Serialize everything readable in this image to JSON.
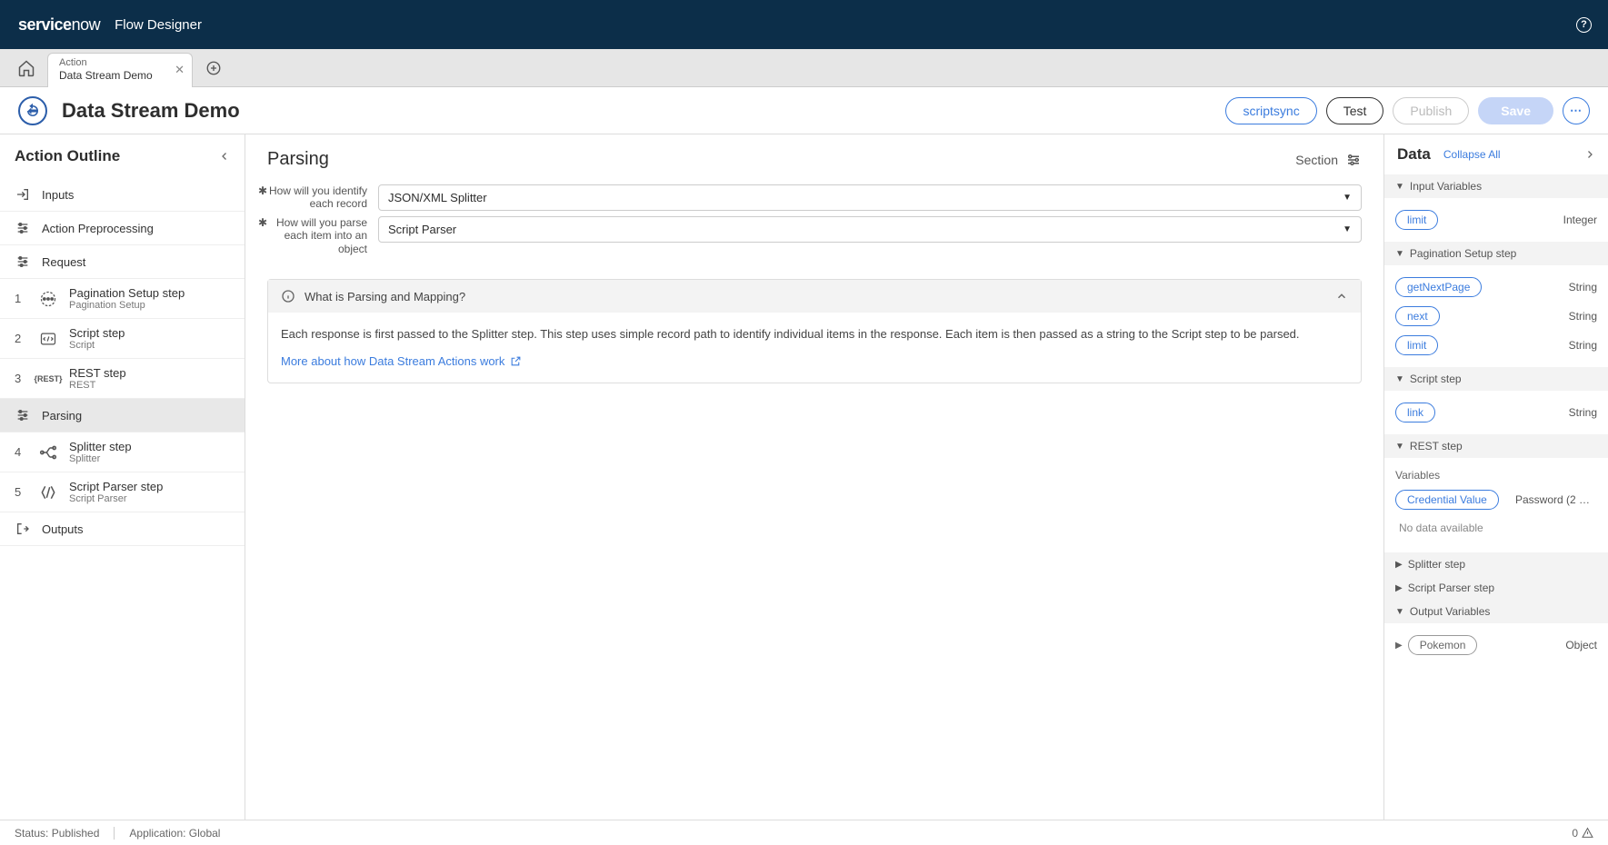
{
  "brand": {
    "name1": "service",
    "name2": "now",
    "product": "Flow Designer"
  },
  "tab": {
    "type": "Action",
    "name": "Data Stream Demo"
  },
  "page": {
    "title": "Data Stream Demo"
  },
  "headerButtons": {
    "scriptsync": "scriptsync",
    "test": "Test",
    "publish": "Publish",
    "save": "Save"
  },
  "outline": {
    "title": "Action Outline",
    "inputs": "Inputs",
    "preprocessing": "Action Preprocessing",
    "request": "Request",
    "parsing": "Parsing",
    "outputs": "Outputs",
    "steps": [
      {
        "num": "1",
        "title": "Pagination Setup step",
        "sub": "Pagination Setup"
      },
      {
        "num": "2",
        "title": "Script step",
        "sub": "Script"
      },
      {
        "num": "3",
        "title": "REST step",
        "sub": "REST"
      }
    ],
    "parseSteps": [
      {
        "num": "4",
        "title": "Splitter step",
        "sub": "Splitter"
      },
      {
        "num": "5",
        "title": "Script Parser step",
        "sub": "Script Parser"
      }
    ]
  },
  "center": {
    "title": "Parsing",
    "sectionLabel": "Section",
    "field1": {
      "label": "How will you identify each record",
      "value": "JSON/XML Splitter"
    },
    "field2": {
      "label": "How will you parse each item into an object",
      "value": "Script Parser"
    },
    "info": {
      "header": "What is Parsing and Mapping?",
      "body": "Each response is first passed to the Splitter step. This step uses simple record path to identify individual items in the response. Each item is then passed as a string to the Script step to be parsed.",
      "link": "More about how Data Stream Actions work"
    }
  },
  "dataPanel": {
    "title": "Data",
    "collapseAll": "Collapse All",
    "sections": {
      "inputVars": "Input Variables",
      "pagination": "Pagination Setup step",
      "script": "Script step",
      "rest": "REST step",
      "splitter": "Splitter step",
      "scriptParser": "Script Parser step",
      "outputVars": "Output Variables"
    },
    "inputVars": [
      {
        "name": "limit",
        "type": "Integer"
      }
    ],
    "paginationVars": [
      {
        "name": "getNextPage",
        "type": "String"
      },
      {
        "name": "next",
        "type": "String"
      },
      {
        "name": "limit",
        "type": "String"
      }
    ],
    "scriptVars": [
      {
        "name": "link",
        "type": "String"
      }
    ],
    "restVarLabel": "Variables",
    "restVars": [
      {
        "name": "Credential Value",
        "type": "Password (2 Way..."
      }
    ],
    "noData": "No data available",
    "outputVars": [
      {
        "name": "Pokemon",
        "type": "Object"
      }
    ]
  },
  "footer": {
    "status": "Status: Published",
    "app": "Application: Global",
    "count": "0"
  }
}
